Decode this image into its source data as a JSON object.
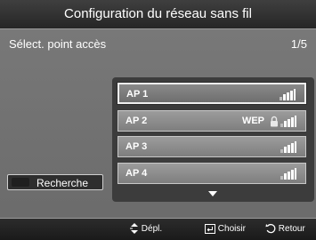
{
  "title": "Configuration du réseau sans fil",
  "subtitle": "Sélect. point accès",
  "page_indicator": "1/5",
  "access_points": [
    {
      "name": "AP 1",
      "security": "",
      "locked": false,
      "signal_bars": 4,
      "selected": true
    },
    {
      "name": "AP 2",
      "security": "WEP",
      "locked": true,
      "signal_bars": 4,
      "selected": false
    },
    {
      "name": "AP 3",
      "security": "",
      "locked": false,
      "signal_bars": 4,
      "selected": false
    },
    {
      "name": "AP 4",
      "security": "",
      "locked": false,
      "signal_bars": 4,
      "selected": false
    }
  ],
  "search_button": {
    "label": "Recherche"
  },
  "footer": {
    "move_label": "Dépl.",
    "select_label": "Choisir",
    "back_label": "Retour"
  },
  "icons": {
    "move": "updown-arrows-icon",
    "select": "enter-icon",
    "back": "return-icon",
    "more": "scroll-down-arrow-icon",
    "lock": "lock-icon",
    "signal": "signal-strength-icon"
  },
  "colors": {
    "background": "#6e6e6e",
    "title_bar": "#2e2e2e",
    "list_panel": "#3c3c3c",
    "row": "#8c8c8c",
    "text": "#ffffff"
  }
}
